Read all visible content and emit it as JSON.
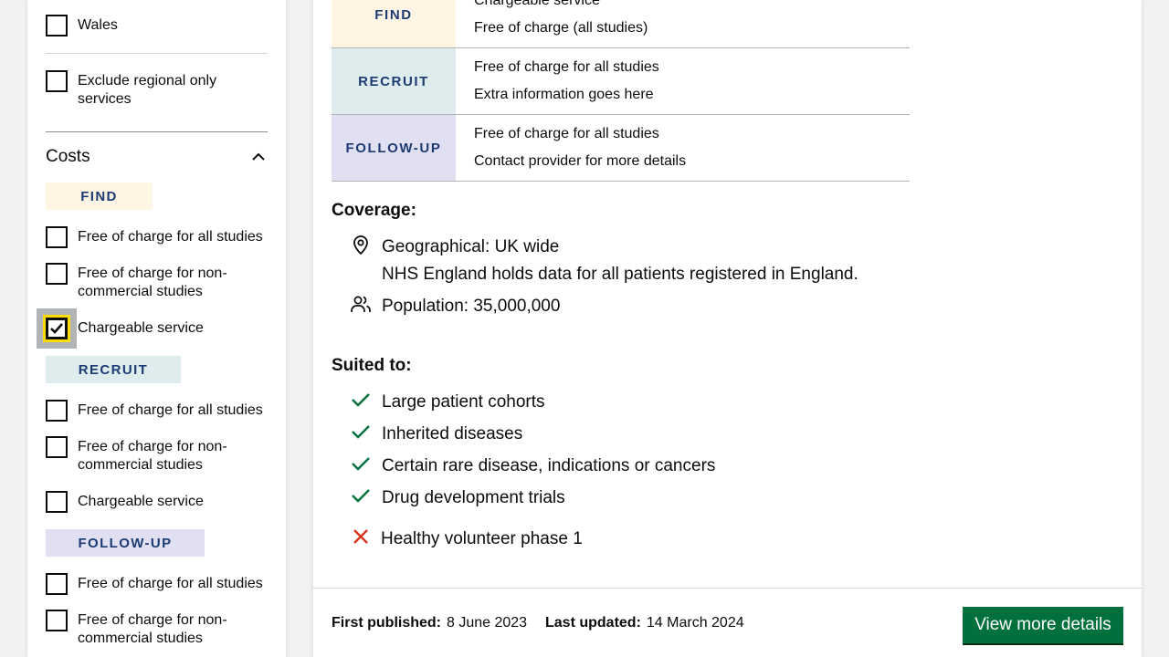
{
  "sidebar": {
    "region_items": [
      {
        "label": "Wales"
      },
      {
        "label": "Exclude regional only services"
      }
    ],
    "costs_section": {
      "title": "Costs",
      "groups": [
        {
          "tag": "FIND",
          "options": [
            {
              "label": "Free of charge for all studies",
              "checked": false
            },
            {
              "label": "Free of charge for non-commercial studies",
              "checked": false
            },
            {
              "label": "Chargeable service",
              "checked": true
            }
          ]
        },
        {
          "tag": "RECRUIT",
          "options": [
            {
              "label": "Free of charge for all studies",
              "checked": false
            },
            {
              "label": "Free of charge for non-commercial studies",
              "checked": false
            },
            {
              "label": "Chargeable service",
              "checked": false
            }
          ]
        },
        {
          "tag": "FOLLOW-UP",
          "options": [
            {
              "label": "Free of charge for all studies",
              "checked": false
            },
            {
              "label": "Free of charge for non-commercial studies",
              "checked": false
            }
          ]
        }
      ]
    }
  },
  "main": {
    "cost_table": [
      {
        "tag": "FIND",
        "lines": [
          "Chargeable service",
          "Free of charge (all studies)"
        ]
      },
      {
        "tag": "RECRUIT",
        "lines": [
          "Free of charge for all studies",
          "Extra information goes here"
        ]
      },
      {
        "tag": "FOLLOW-UP",
        "lines": [
          "Free of charge for all studies",
          "Contact provider for more details"
        ]
      }
    ],
    "coverage": {
      "heading": "Coverage:",
      "geographical": "Geographical: UK wide",
      "geographical_note": "NHS England holds data for all patients registered in England.",
      "population": "Population: 35,000,000"
    },
    "suited_to": {
      "heading": "Suited to:",
      "yes": [
        "Large patient cohorts",
        "Inherited diseases",
        "Certain rare disease, indications or cancers",
        "Drug development trials"
      ],
      "no": [
        "Healthy volunteer phase 1"
      ]
    },
    "footer": {
      "first_published_label": "First published:",
      "first_published": "8 June 2023",
      "last_updated_label": "Last updated:",
      "last_updated": "14 March 2024",
      "button": "View more details"
    }
  },
  "colors": {
    "find_bg": "#fff5e5",
    "recruit_bg": "#dfeced",
    "follow_up_bg": "#e1e0f2",
    "tag_text": "#1d3b73",
    "tick_green": "#00703c",
    "cross_red": "#d4351c",
    "focus_yellow": "#ffdd00",
    "button_green": "#00703c"
  }
}
